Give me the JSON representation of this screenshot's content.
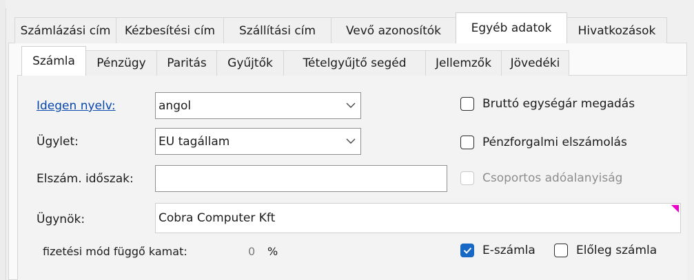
{
  "outer_tabs": [
    {
      "label": "Számlázási cím",
      "active": false
    },
    {
      "label": "Kézbesítési cím",
      "active": false
    },
    {
      "label": "Szállítási cím",
      "active": false
    },
    {
      "label": "Vevő azonosítók",
      "active": false
    },
    {
      "label": "Egyéb adatok",
      "active": true
    },
    {
      "label": "Hivatkozások",
      "active": false
    }
  ],
  "inner_tabs": [
    {
      "label": "Számla",
      "active": true
    },
    {
      "label": "Pénzügy",
      "active": false
    },
    {
      "label": "Paritás",
      "active": false
    },
    {
      "label": "Gyűjtők",
      "active": false
    },
    {
      "label": "Tételgyűjtő segéd",
      "active": false
    },
    {
      "label": "Jellemzők",
      "active": false
    },
    {
      "label": "Jövedéki",
      "active": false
    }
  ],
  "form": {
    "foreign_language": {
      "label": "Idegen nyelv:",
      "value": "angol"
    },
    "transaction": {
      "label": "Ügylet:",
      "value": "EU tagállam"
    },
    "settlement_period": {
      "label": "Elszám. időszak:",
      "value": ""
    },
    "agent": {
      "label": "Ügynök:",
      "value": "Cobra Computer Kft"
    },
    "interest": {
      "label": "fizetési mód függő kamat:",
      "value": "0",
      "unit": "%"
    }
  },
  "checkboxes": {
    "gross_unit_price": {
      "label": "Bruttó egységár megadás",
      "checked": false,
      "disabled": false
    },
    "cash_accounting": {
      "label": "Pénzforgalmi elszámolás",
      "checked": false,
      "disabled": false
    },
    "group_taxation": {
      "label": "Csoportos adóalanyiság",
      "checked": false,
      "disabled": true
    },
    "e_invoice": {
      "label": "E-számla",
      "checked": true,
      "disabled": false
    },
    "advance_invoice": {
      "label": "Előleg számla",
      "checked": false,
      "disabled": false
    }
  },
  "colors": {
    "accent": "#1768c4",
    "link": "#0645ad",
    "marker": "#ee00cc"
  }
}
